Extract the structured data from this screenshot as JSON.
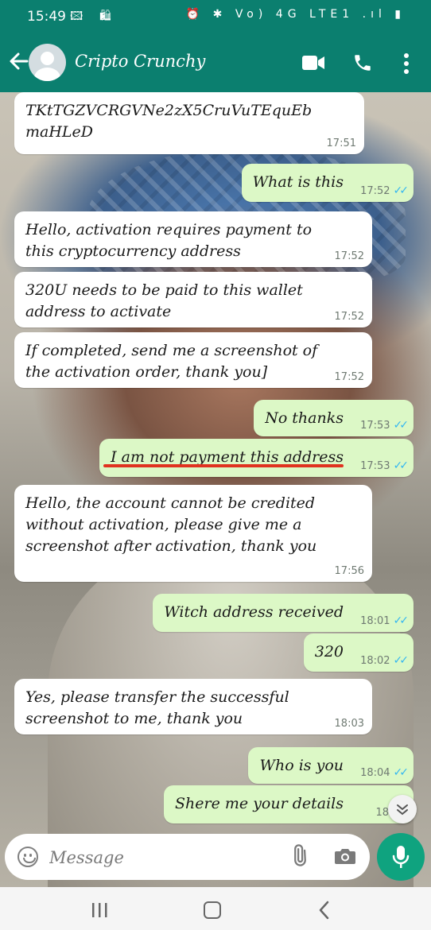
{
  "status_bar": {
    "time": "15:49",
    "left_icons": "🖾 🛍",
    "right_icons": "⏰ ✱ Vo) 4G LTE1 .ıl ▮"
  },
  "header": {
    "contact_name": "Cripto Crunchy"
  },
  "messages": [
    {
      "direction": "in",
      "text": "TKtTGZVCRGVNe2zX5CruVuTEquEbmaHLeD",
      "time": "17:51"
    },
    {
      "direction": "out",
      "text": "What is this",
      "time": "17:52",
      "ticks": "✓✓"
    },
    {
      "direction": "in",
      "text": "Hello, activation requires payment to this cryptocurrency address",
      "time": "17:52"
    },
    {
      "direction": "in",
      "text": "320U needs to be paid to this wallet address to activate",
      "time": "17:52"
    },
    {
      "direction": "in",
      "text": "If completed, send me a screenshot of the activation order, thank you]",
      "time": "17:52"
    },
    {
      "direction": "out",
      "text": "No thanks",
      "time": "17:53",
      "ticks": "✓✓"
    },
    {
      "direction": "out",
      "text": "I am not payment this address",
      "time": "17:53",
      "ticks": "✓✓"
    },
    {
      "direction": "in",
      "text": "Hello, the account cannot be credited without activation, please give me a screenshot after activation, thank you",
      "time": "17:56"
    },
    {
      "direction": "out",
      "text": "Witch address received",
      "time": "18:01",
      "ticks": "✓✓"
    },
    {
      "direction": "out",
      "text": "320",
      "time": "18:02",
      "ticks": "✓✓"
    },
    {
      "direction": "in",
      "text": "Yes, please transfer the successful screenshot to me, thank you",
      "time": "18:03"
    },
    {
      "direction": "out",
      "text": "Who is you",
      "time": "18:04",
      "ticks": "✓✓"
    },
    {
      "direction": "out",
      "text": "Shere me your details",
      "time": "18:04"
    }
  ],
  "input": {
    "placeholder": "Message"
  },
  "colors": {
    "header_green": "#0b7f6f",
    "outgoing_bubble": "#dcf8c6",
    "incoming_bubble": "#ffffff",
    "read_ticks": "#34b7f1",
    "mic_button": "#0fa37f",
    "annotation_underline": "#e0321f"
  },
  "icons": [
    "back-arrow-icon",
    "avatar-icon",
    "video-call-icon",
    "voice-call-icon",
    "more-options-icon",
    "emoji-icon",
    "attach-icon",
    "camera-icon",
    "mic-icon",
    "scroll-down-icon",
    "recents-icon",
    "home-icon",
    "nav-back-icon"
  ]
}
